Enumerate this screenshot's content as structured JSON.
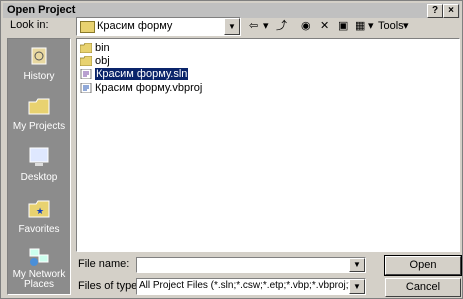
{
  "dialog": {
    "title": "Open Project",
    "help_glyph": "?",
    "close_glyph": "×"
  },
  "lookin": {
    "label": "Look in:",
    "value": "Красим форму"
  },
  "toolbar": {
    "tools_label": "Tools",
    "back_glyph": "⇦",
    "up_glyph": "⤴",
    "search_glyph": "◉",
    "delete_glyph": "✕",
    "new_folder_glyph": "▣",
    "views_glyph": "▦",
    "caret": "▾"
  },
  "places": [
    {
      "label": "History",
      "icon": "history-icon"
    },
    {
      "label": "My Projects",
      "icon": "my-projects-icon"
    },
    {
      "label": "Desktop",
      "icon": "desktop-icon"
    },
    {
      "label": "Favorites",
      "icon": "favorites-icon"
    },
    {
      "label": "My Network Places",
      "icon": "network-places-icon"
    }
  ],
  "files": [
    {
      "name": "bin",
      "icon": "folder-icon"
    },
    {
      "name": "obj",
      "icon": "folder-icon"
    },
    {
      "name": "Красим форму.sln",
      "icon": "solution-file-icon",
      "selected": true
    },
    {
      "name": "Красим форму.vbproj",
      "icon": "vbproj-file-icon"
    }
  ],
  "filename": {
    "label": "File name:",
    "value": ""
  },
  "filetype": {
    "label": "Files of type:",
    "value": "All Project Files (*.sln;*.csw;*.etp;*.vbp;*.vbproj;*.vbdp"
  },
  "buttons": {
    "open": "Open",
    "cancel": "Cancel"
  },
  "colors": {
    "selection": "#0a246a",
    "places_bg": "#8c8c8c",
    "dialog_bg": "#d4d0c8"
  }
}
